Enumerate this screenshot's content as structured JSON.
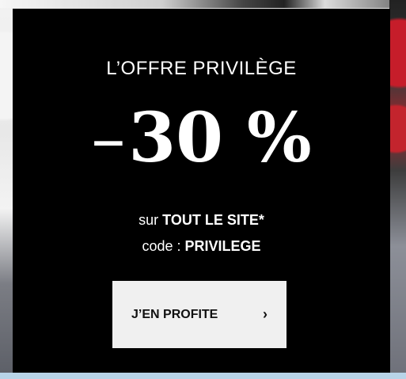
{
  "promo": {
    "title": "L’OFFRE PRIVILÈGE",
    "discount_sign": "–",
    "discount_value": "30 %",
    "site_prefix": "sur",
    "site_text": "TOUT LE SITE*",
    "code_prefix": "code :",
    "code_value": "PRIVILEGE"
  },
  "cta": {
    "label": "J’EN PROFITE",
    "chevron": "›"
  },
  "colors": {
    "card": "#000000",
    "button": "#f0f0f0",
    "text": "#ffffff"
  },
  "icons": {
    "chevron": "chevron-right-icon"
  }
}
